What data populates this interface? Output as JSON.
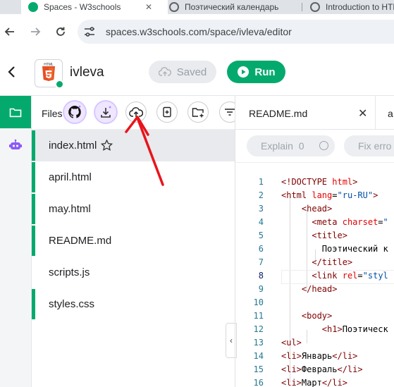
{
  "browser": {
    "tabs": [
      {
        "title": "Spaces - W3schools",
        "active": true
      },
      {
        "title": "Поэтический календарь",
        "active": false
      },
      {
        "title": "Introduction to HTML",
        "active": false
      }
    ],
    "url": "spaces.w3schools.com/space/ivleva/editor"
  },
  "header": {
    "project_name": "ivleva",
    "logo_text": "HTML",
    "saved_label": "Saved",
    "run_label": "Run"
  },
  "files": {
    "label": "Files",
    "items": [
      {
        "name": "index.html",
        "selected": true,
        "starred": true,
        "marked": true
      },
      {
        "name": "april.html",
        "selected": false,
        "starred": false,
        "marked": true
      },
      {
        "name": "may.html",
        "selected": false,
        "starred": false,
        "marked": true
      },
      {
        "name": "README.md",
        "selected": false,
        "starred": false,
        "marked": true
      },
      {
        "name": "scripts.js",
        "selected": false,
        "starred": false,
        "marked": false
      },
      {
        "name": "styles.css",
        "selected": false,
        "starred": false,
        "marked": true
      }
    ],
    "collapse_glyph": "‹"
  },
  "editor": {
    "tabs": [
      {
        "name": "README.md"
      },
      {
        "name": "a"
      }
    ],
    "close_glyph": "✕",
    "explain_label": "Explain",
    "explain_count": "0",
    "fix_label": "Fix erro"
  },
  "code_lines": [
    "<!DOCTYPE html>",
    "<html lang=\"ru-RU\">",
    "<head>",
    "<meta charset=\"",
    "<title>",
    "Поэтический к",
    "</title>",
    "<link rel=\"styl",
    "</head>",
    "",
    "<body>",
    "<h1>Поэтическ",
    "<ul>",
    "<li>Январь</li>",
    "<li>Февраль</li>",
    "<li>Март</li>"
  ],
  "colors": {
    "brand_green": "#04aa6d",
    "annotation_red": "#e8141b",
    "ai_purple": "#8b5cf6"
  }
}
